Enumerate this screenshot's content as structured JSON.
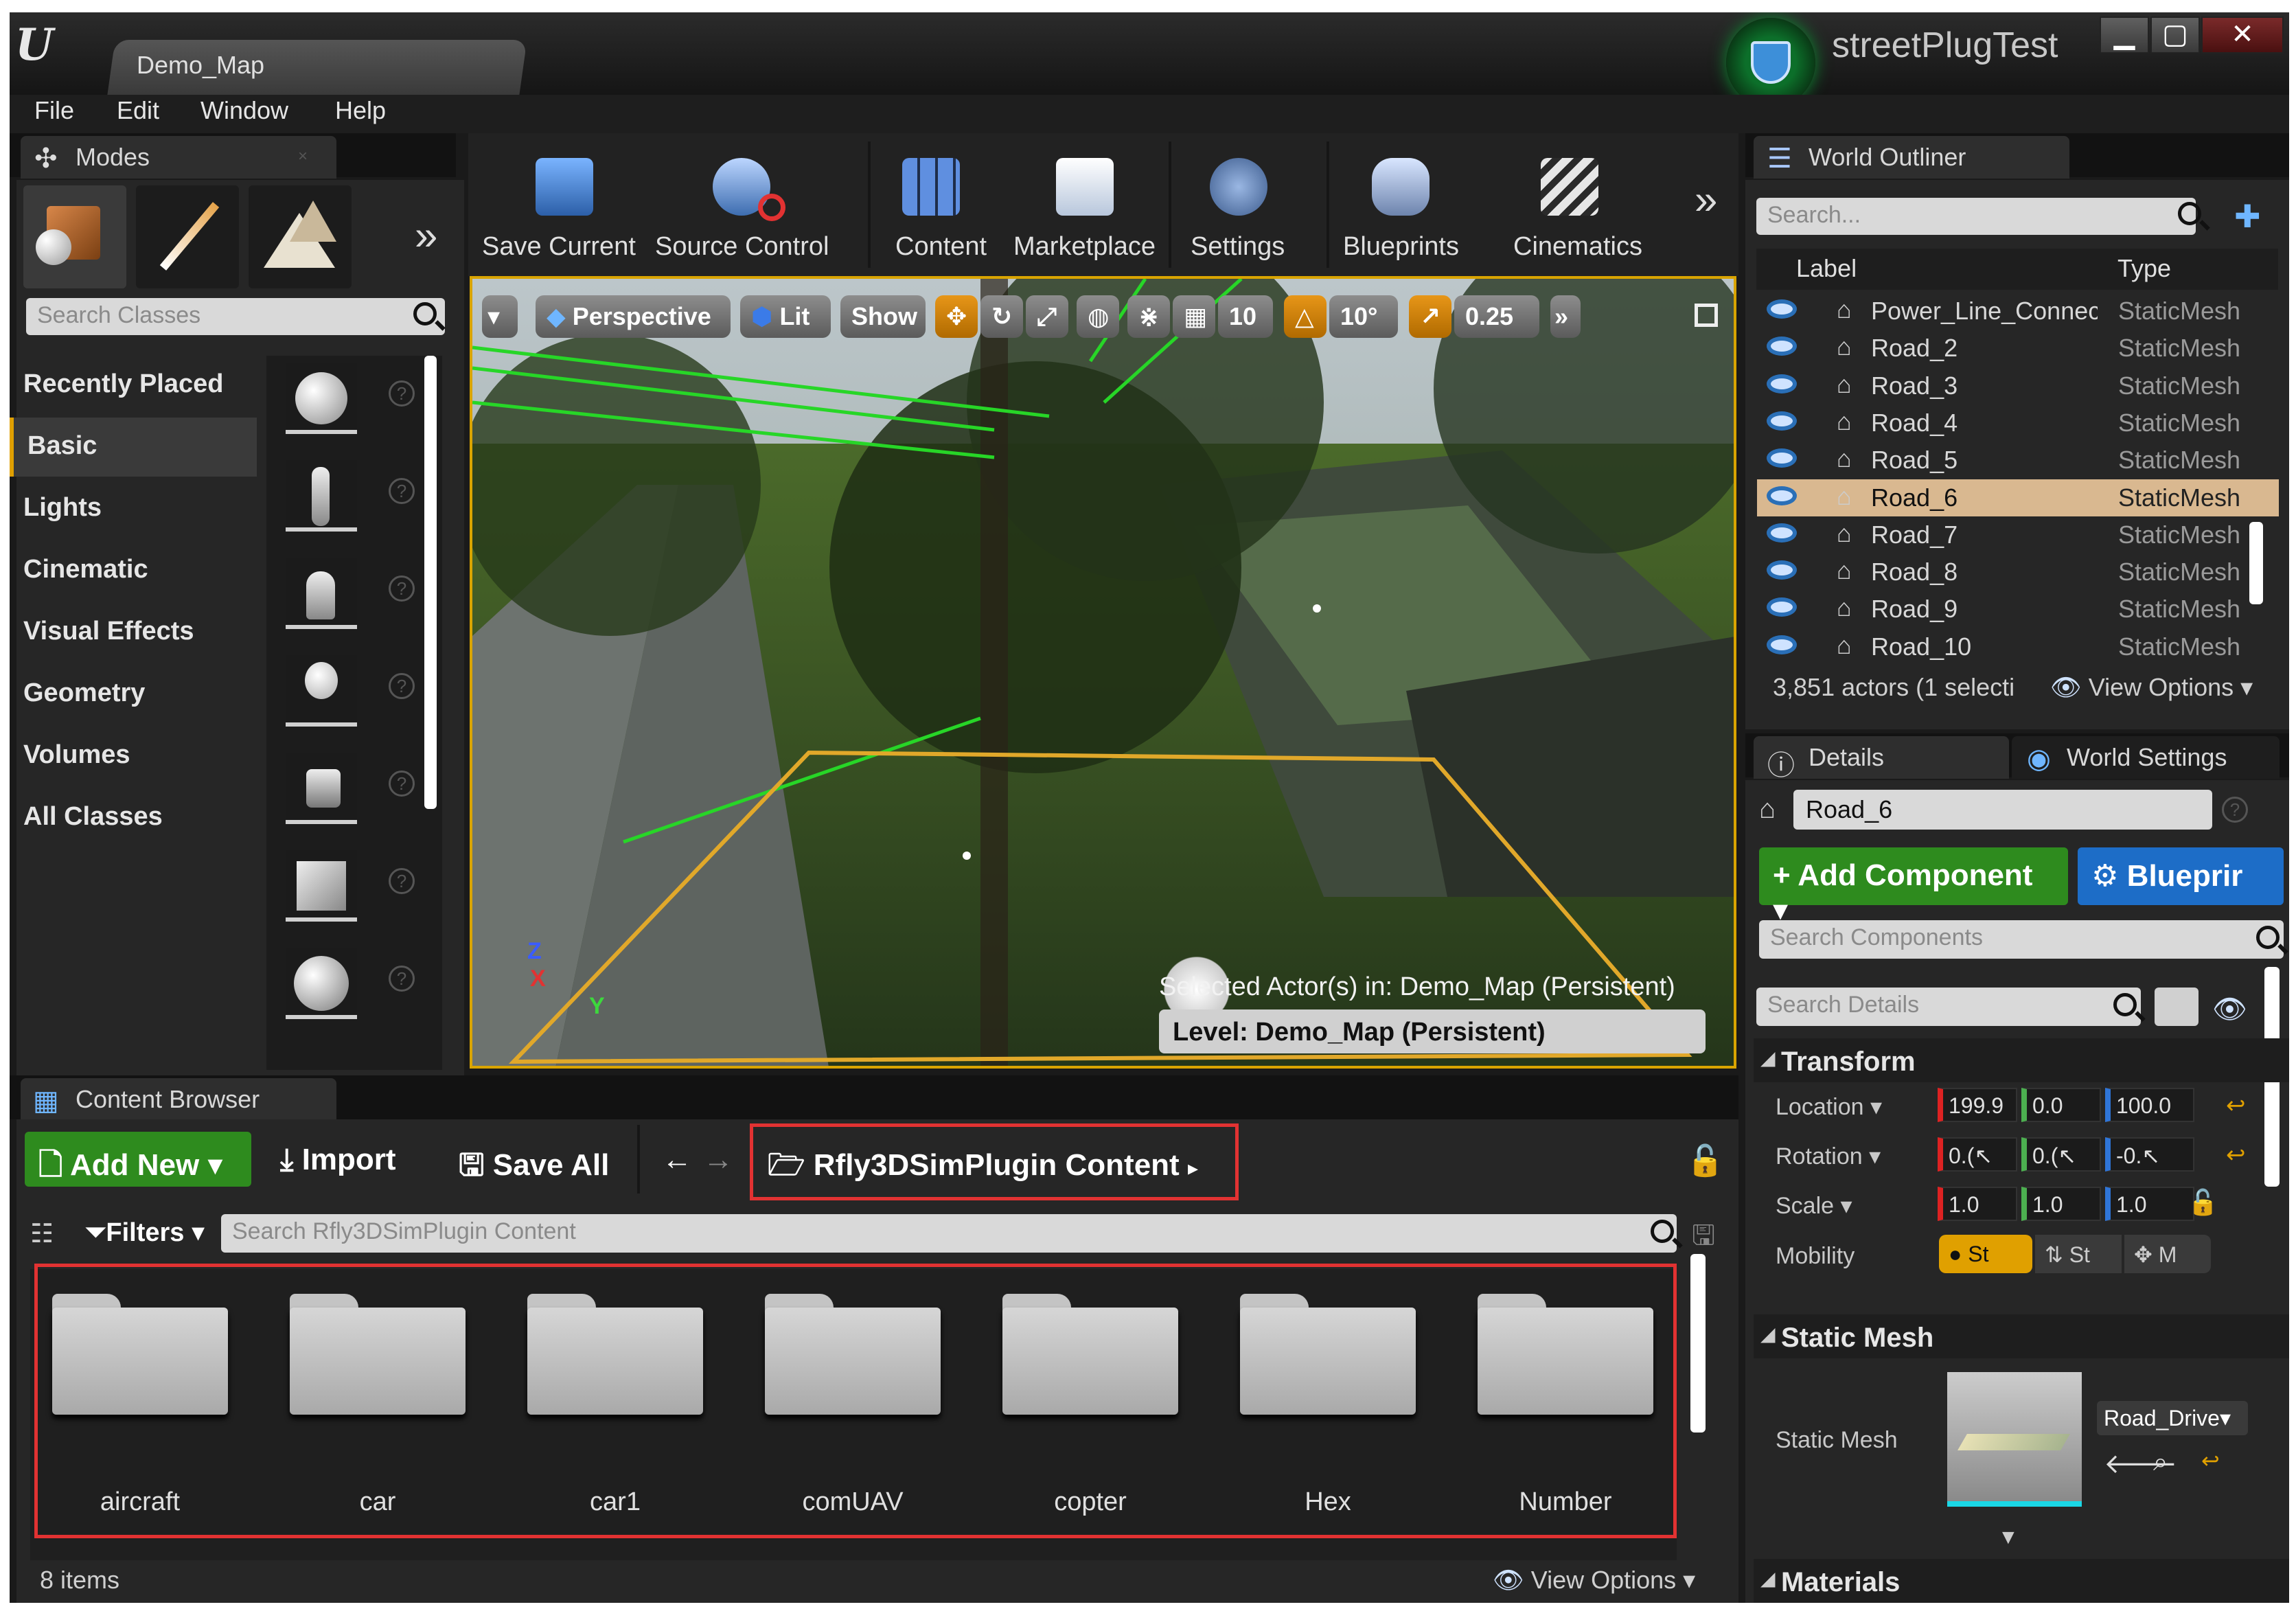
{
  "window": {
    "app_logo": "U",
    "document_tab": "Demo_Map",
    "project_name": "streetPlugTest",
    "controls": [
      "▁",
      "▢",
      "✕"
    ]
  },
  "menu": [
    "File",
    "Edit",
    "Window",
    "Help"
  ],
  "modes": {
    "tab_label": "Modes",
    "tab_close": "×",
    "more": "»",
    "search_placeholder": "Search Classes",
    "categories": [
      "Recently Placed",
      "Basic",
      "Lights",
      "Cinematic",
      "Visual Effects",
      "Geometry",
      "Volumes",
      "All Classes"
    ],
    "selected_category": "Basic",
    "help_glyph": "?"
  },
  "toolbar": {
    "items": [
      "Save Current",
      "Source Control",
      "Content",
      "Marketplace",
      "Settings",
      "Blueprints",
      "Cinematics"
    ],
    "more": "»"
  },
  "viewport": {
    "dropdown": "▾",
    "perspective": "Perspective",
    "lit": "Lit",
    "show": "Show",
    "grid_snap": "10",
    "rotation_snap": "10°",
    "scale_snap": "0.25",
    "more": "»",
    "selected_actors": "Selected Actor(s) in:  Demo_Map (Persistent)",
    "level": "Level:  Demo_Map (Persistent)",
    "axis_z": "Z",
    "axis_x": "X",
    "axis_y": "Y"
  },
  "world_outliner": {
    "tab_label": "World Outliner",
    "search_placeholder": "Search...",
    "col_label": "Label",
    "col_type": "Type",
    "rows": [
      {
        "label": "Power_Line_Connec",
        "type": "StaticMesh"
      },
      {
        "label": "Road_2",
        "type": "StaticMesh"
      },
      {
        "label": "Road_3",
        "type": "StaticMesh"
      },
      {
        "label": "Road_4",
        "type": "StaticMesh"
      },
      {
        "label": "Road_5",
        "type": "StaticMesh"
      },
      {
        "label": "Road_6",
        "type": "StaticMesh"
      },
      {
        "label": "Road_7",
        "type": "StaticMesh"
      },
      {
        "label": "Road_8",
        "type": "StaticMesh"
      },
      {
        "label": "Road_9",
        "type": "StaticMesh"
      },
      {
        "label": "Road_10",
        "type": "StaticMesh"
      }
    ],
    "selected_row": "Road_6",
    "actor_count": "3,851 actors (1 selecti",
    "view_options": "View Options"
  },
  "details": {
    "tab_details": "Details",
    "tab_world_settings": "World Settings",
    "actor_name": "Road_6",
    "add_component": "+ Add Component ▾",
    "blueprint": "Blueprir",
    "search_components": "Search Components",
    "search_details": "Search Details",
    "transform_header": "Transform",
    "location_label": "Location ▾",
    "location": [
      "199.9",
      "0.0",
      "100.0"
    ],
    "rotation_label": "Rotation ▾",
    "rotation": [
      "0.(↖",
      "0.(↖",
      "-0.↖"
    ],
    "scale_label": "Scale ▾",
    "scale": [
      "1.0",
      "1.0",
      "1.0"
    ],
    "mobility_label": "Mobility",
    "mobility_options": [
      "St",
      "St",
      "M"
    ],
    "static_mesh_header": "Static Mesh",
    "static_mesh_label": "Static Mesh",
    "static_mesh_value": "Road_Drive▾",
    "materials_header": "Materials",
    "reset_glyph": "↩"
  },
  "content_browser": {
    "tab_label": "Content Browser",
    "add_new": "Add New ▾",
    "import": "Import",
    "save_all": "Save All",
    "path": "Rfly3DSimPlugin Content",
    "filters": "Filters ▾",
    "search_placeholder": "Search Rfly3DSimPlugin Content",
    "folders": [
      "aircraft",
      "car",
      "car1",
      "comUAV",
      "copter",
      "Hex",
      "Number"
    ],
    "item_count": "8 items",
    "view_options": "View Options ▾"
  },
  "colors": {
    "accent_orange": "#e0a000",
    "highlight_red": "#e23232",
    "add_green": "#2e8b1e",
    "blueprint_blue": "#1d6dc7",
    "selected_row": "#d9b890"
  }
}
